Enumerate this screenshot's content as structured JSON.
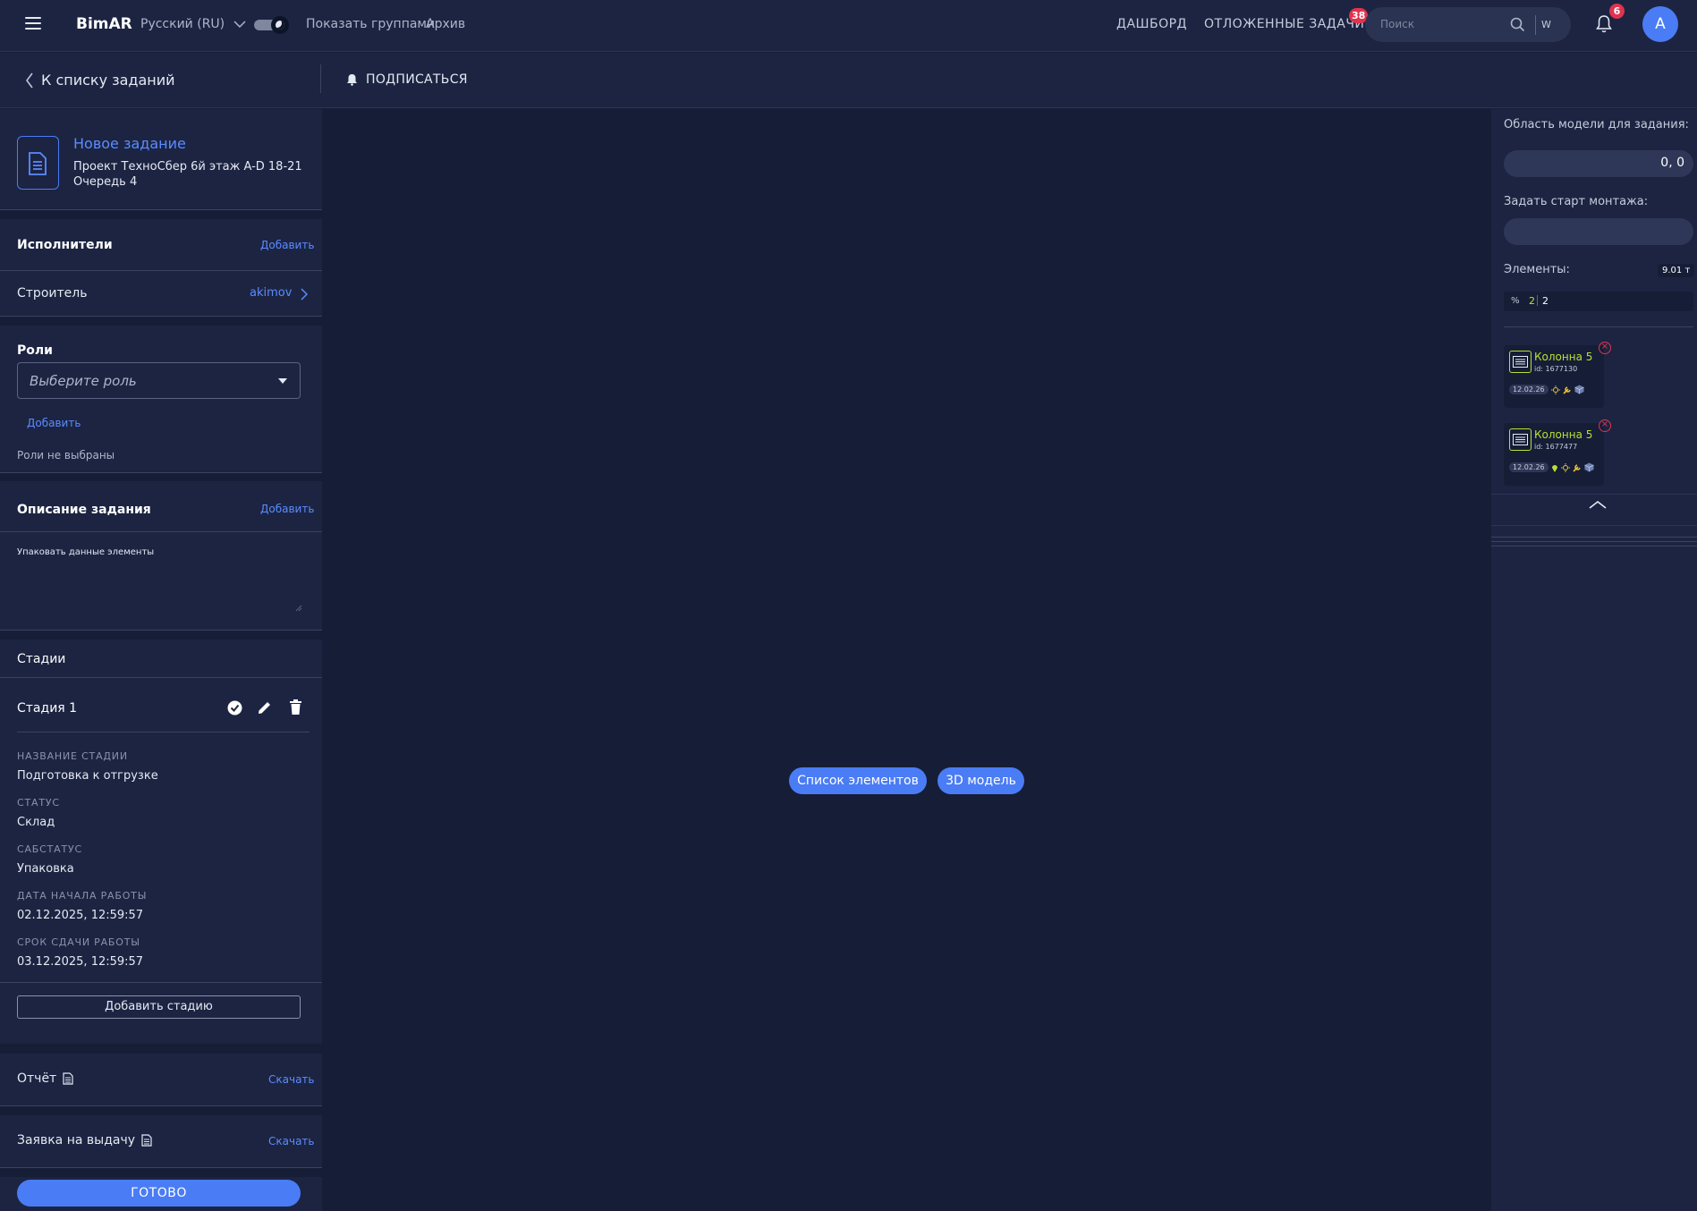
{
  "topbar": {
    "brand": "BimAR",
    "language": "Русский (RU)",
    "show_groups": "Показать группами",
    "archive": "Архив",
    "dashboard": "ДАШБОРД",
    "deferred_tasks": "ОТЛОЖЕННЫЕ ЗАДАЧИ",
    "deferred_count": "38",
    "search_placeholder": "Поиск",
    "search_key": "W",
    "notifications_count": "6",
    "avatar_letter": "A"
  },
  "subbar": {
    "back": "К списку заданий",
    "subscribe": "ПОДПИСАТЬСЯ"
  },
  "task": {
    "title": "Новое задание",
    "project": "Проект ТехноСбер 6й этаж A-D 18-21",
    "queue": "Очередь 4"
  },
  "executors": {
    "title": "Исполнители",
    "add": "Добавить",
    "role": "Строитель",
    "user": "akimov"
  },
  "roles": {
    "title": "Роли",
    "select_placeholder": "Выберите роль",
    "add": "Добавить",
    "empty": "Роли не выбраны"
  },
  "description": {
    "title": "Описание задания",
    "add": "Добавить",
    "text": "Упаковать данные элементы"
  },
  "stages": {
    "title": "Стадии",
    "stage_name": "Стадия 1",
    "fields": [
      {
        "label": "НАЗВАНИЕ СТАДИИ",
        "value": "Подготовка к отгрузке"
      },
      {
        "label": "СТАТУС",
        "value": "Склад"
      },
      {
        "label": "САБСТАТУС",
        "value": "Упаковка"
      },
      {
        "label": "ДАТА НАЧАЛА РАБОТЫ",
        "value": "02.12.2025, 12:59:57"
      },
      {
        "label": "СРОК СДАЧИ РАБОТЫ",
        "value": "03.12.2025, 12:59:57"
      }
    ],
    "add_stage": "Добавить стадию"
  },
  "report": {
    "title": "Отчёт",
    "download": "Скачать"
  },
  "issue_request": {
    "title": "Заявка на выдачу",
    "download": "Скачать"
  },
  "done": "ГОТОВО",
  "center": {
    "elements_list": "Список элементов",
    "model_3d": "3D модель"
  },
  "right": {
    "model_area_label": "Область модели для задания:",
    "model_area_value": "0, 0",
    "start_label": "Задать старт монтажа:",
    "elements_label": "Элементы:",
    "weight": "9.01 т",
    "percent_symbol": "%",
    "count_done": "2",
    "count_total": "2",
    "elements": [
      {
        "name": "Колонна 5",
        "id": "id: 1677130",
        "date": "12.02.26"
      },
      {
        "name": "Колонна 5",
        "id": "id: 1677477",
        "date": "12.02.26"
      }
    ]
  },
  "colors": {
    "accent": "#4a7cf5",
    "badge": "#e0334f",
    "element_green": "#b8e034",
    "background": "#161d36",
    "panel": "#1c2442"
  }
}
